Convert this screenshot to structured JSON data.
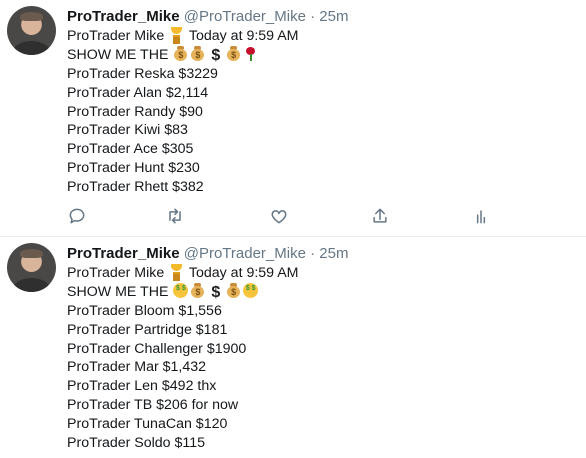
{
  "tweets": [
    {
      "name": "ProTrader_Mike",
      "handle": "@ProTrader_Mike",
      "separator": "·",
      "time": "25m",
      "intro_name": "ProTrader Mike",
      "intro_time": "Today at 9:59 AM",
      "show_text": "SHOW ME THE",
      "lines": [
        "ProTrader Reska $3229",
        "ProTrader Alan $2,114",
        "ProTrader Randy $90",
        "ProTrader Kiwi $83",
        "ProTrader Ace $305",
        "ProTrader Hunt $230",
        "ProTrader Rhett $382"
      ]
    },
    {
      "name": "ProTrader_Mike",
      "handle": "@ProTrader_Mike",
      "separator": "·",
      "time": "25m",
      "intro_name": "ProTrader Mike",
      "intro_time": "Today at 9:59 AM",
      "show_text": "SHOW ME THE",
      "lines": [
        "ProTrader Bloom $1,556",
        "ProTrader Partridge $181",
        "ProTrader Challenger $1900",
        "ProTrader Mar $1,432",
        "ProTrader Len $492 thx",
        "ProTrader TB $206 for now",
        "ProTrader TunaCan $120",
        "ProTrader Soldo $115"
      ]
    }
  ],
  "icons": {
    "reply": "reply-icon",
    "retweet": "retweet-icon",
    "like": "like-icon",
    "share": "share-icon",
    "analytics": "analytics-icon",
    "trophy": "trophy-emoji",
    "money_bag": "money-bag-emoji",
    "dollar": "$",
    "rose": "rose-emoji",
    "money_face": "money-mouth-face-emoji"
  },
  "colors": {
    "text": "#14171a",
    "secondary": "#657786",
    "icon": "#657786",
    "divider": "#e6ecf0"
  }
}
